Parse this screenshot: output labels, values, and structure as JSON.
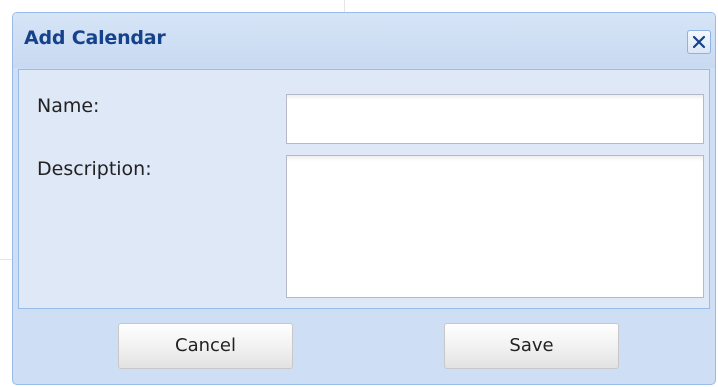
{
  "dialog": {
    "title": "Add Calendar",
    "close_icon": "close-icon"
  },
  "form": {
    "name_label": "Name:",
    "name_value": "",
    "description_label": "Description:",
    "description_value": ""
  },
  "buttons": {
    "cancel_label": "Cancel",
    "save_label": "Save"
  },
  "colors": {
    "title_text": "#15428b",
    "dialog_bg": "#cedff5",
    "panel_bg": "#dfe8f6",
    "border": "#99bbe8"
  }
}
